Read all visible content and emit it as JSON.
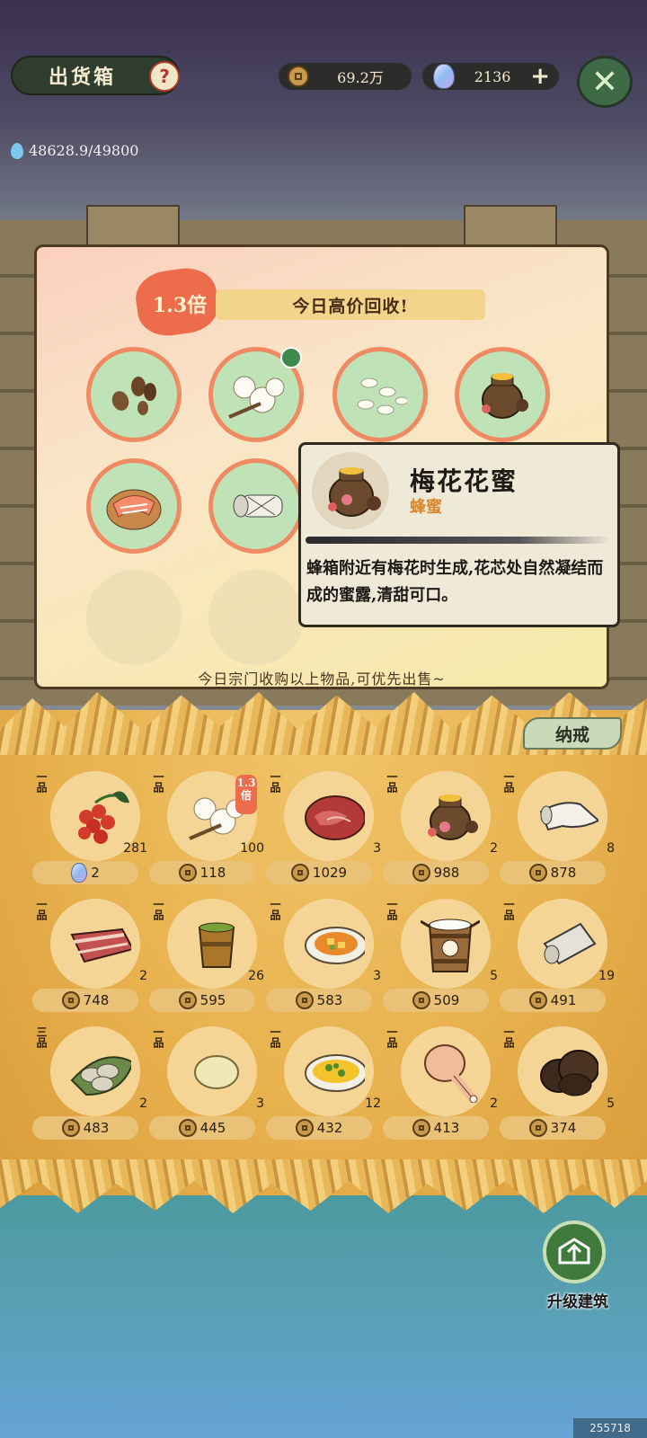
{
  "header": {
    "title": "出货箱",
    "help_glyph": "?",
    "coins": "69.2万",
    "gems": "2136",
    "add_glyph": "+",
    "close_glyph": "✕",
    "water": "48628.9/49800"
  },
  "board": {
    "multiplier": "1.3倍",
    "banner": "今日高价回收!",
    "note": "今日宗门收购以上物品,可优先出售~",
    "slots": [
      "seeds-icon",
      "cotton-icon",
      "rice-icon",
      "honey-jar-icon",
      "salmon-icon",
      "scroll-icon"
    ]
  },
  "tooltip": {
    "name": "梅花花蜜",
    "type": "蜂蜜",
    "description": "蜂箱附近有梅花时生成,花芯处自然凝结而成的蜜露,清甜可口。"
  },
  "shelf": {
    "tab": "纳戒",
    "items": [
      {
        "grade": "一品",
        "icon": "red-berries-icon",
        "count": "281",
        "price": "2",
        "currency": "gem"
      },
      {
        "grade": "一品",
        "icon": "cotton-icon",
        "count": "100",
        "price": "118",
        "currency": "coin",
        "badge": "1.3倍"
      },
      {
        "grade": "一品",
        "icon": "meat-icon",
        "count": "3",
        "price": "1029",
        "currency": "coin"
      },
      {
        "grade": "一品",
        "icon": "honey-jar-icon",
        "count": "2",
        "price": "988",
        "currency": "coin"
      },
      {
        "grade": "一品",
        "icon": "cloth-icon",
        "count": "8",
        "price": "878",
        "currency": "coin"
      },
      {
        "grade": "一品",
        "icon": "bacon-icon",
        "count": "2",
        "price": "748",
        "currency": "coin"
      },
      {
        "grade": "一品",
        "icon": "tea-cup-icon",
        "count": "26",
        "price": "595",
        "currency": "coin"
      },
      {
        "grade": "一品",
        "icon": "stew-plate-icon",
        "count": "3",
        "price": "583",
        "currency": "coin"
      },
      {
        "grade": "一品",
        "icon": "milk-bucket-icon",
        "count": "5",
        "price": "509",
        "currency": "coin"
      },
      {
        "grade": "一品",
        "icon": "paper-roll-icon",
        "count": "19",
        "price": "491",
        "currency": "coin"
      },
      {
        "grade": "三品",
        "icon": "dumplings-icon",
        "count": "2",
        "price": "483",
        "currency": "coin"
      },
      {
        "grade": "一品",
        "icon": "dough-ball-icon",
        "count": "3",
        "price": "445",
        "currency": "coin"
      },
      {
        "grade": "一品",
        "icon": "egg-dish-icon",
        "count": "12",
        "price": "432",
        "currency": "coin"
      },
      {
        "grade": "一品",
        "icon": "chicken-leg-icon",
        "count": "2",
        "price": "413",
        "currency": "coin"
      },
      {
        "grade": "一品",
        "icon": "truffle-icon",
        "count": "5",
        "price": "374",
        "currency": "coin"
      }
    ]
  },
  "upgrade": {
    "label": "升级建筑"
  },
  "watermark": "255718"
}
